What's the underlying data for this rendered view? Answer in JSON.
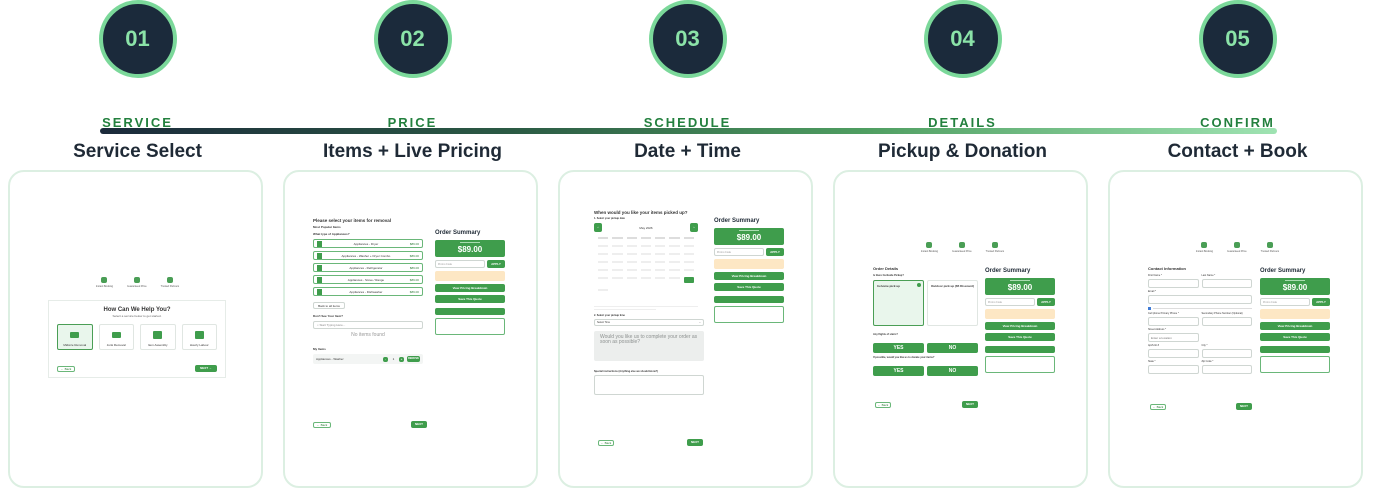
{
  "steps": [
    {
      "num": "01",
      "label": "SERVICE",
      "title": "Service Select"
    },
    {
      "num": "02",
      "label": "PRICE",
      "title": "Items + Live Pricing"
    },
    {
      "num": "03",
      "label": "SCHEDULE",
      "title": "Date + Time"
    },
    {
      "num": "04",
      "label": "DETAILS",
      "title": "Pickup & Donation"
    },
    {
      "num": "05",
      "label": "CONFIRM",
      "title": "Contact + Book"
    }
  ],
  "colors": {
    "badge_bg": "#1b2a3b",
    "accent_green": "#3f9d4c",
    "ring": "#7bd89a"
  },
  "screen1": {
    "header_icons": [
      "Instant Booking",
      "Guaranteed Price",
      "Trusted Partners"
    ],
    "heading": "How Can We Help You?",
    "subheading": "Select a service below to get started.",
    "services": [
      "Midsize Removal",
      "Junk Removal",
      "Item Assembly",
      "Hourly Labour"
    ],
    "back": "← Back",
    "next": "NEXT →"
  },
  "screen2": {
    "heading": "Please select your items for removal",
    "sub1": "Most Popular Items",
    "sub2": "What type of Appliances?",
    "items": [
      {
        "name": "Appliances - Dryer",
        "price": "$89.00"
      },
      {
        "name": "Appliances - Washer + Dryer Combo",
        "price": "$89.00"
      },
      {
        "name": "Appliances - Refrigerator",
        "price": "$89.00"
      },
      {
        "name": "Appliances - Stove / Range",
        "price": "$89.00"
      },
      {
        "name": "Appliances - Dishwasher",
        "price": "$89.00"
      }
    ],
    "back_all": "Back to all items",
    "dont_see": "Don't See Your Item?",
    "search_placeholder": "Start Typing Here...",
    "no_items": "No items found",
    "my_items": "My Items",
    "my_item_name": "Appliances - Washer",
    "qty": "1",
    "remove": "REMOVE",
    "back": "← Back",
    "next": "NEXT"
  },
  "summary": {
    "title": "Order Summary",
    "price": "$89.00",
    "promo_placeholder": "Promo Code",
    "apply": "APPLY",
    "view_breakdown": "View Pricing Breakdown",
    "save_quote": "Save This Quote"
  },
  "screen3": {
    "heading": "When would you like your items picked up?",
    "q1": "1. Select your pickup date",
    "month": "May 2026",
    "q2": "2. Select your pickup time",
    "time_select": "Select Time",
    "asap": "Would you like us to complete your order as soon as possible?",
    "notes_label": "Special instructions (Anything else we should know?)",
    "back": "← Back",
    "next": "NEXT"
  },
  "screen4": {
    "heading": "Order Details",
    "q1": "Is there Curbside Pickup?",
    "opt1": "In-home pick up",
    "opt2": "Outdoor pick up ($5 Discount)",
    "q2": "Any flights of stairs?",
    "q3": "If possible, would you like us to donate your items?",
    "yes": "YES",
    "no": "NO",
    "back": "← Back",
    "next": "NEXT"
  },
  "screen5": {
    "heading": "Contact Information",
    "first_name": "First Name *",
    "last_name": "Last Name *",
    "email": "Email *",
    "phone": "Cell phone Primary Phone *",
    "phone2": "Secondary Phone Number (Optional)",
    "address": "Street Address *",
    "address_placeholder": "Enter a location",
    "apt": "Apt/Unit #",
    "city": "City *",
    "state": "State *",
    "zip": "Zip Code *",
    "back": "← Back",
    "next": "NEXT"
  }
}
